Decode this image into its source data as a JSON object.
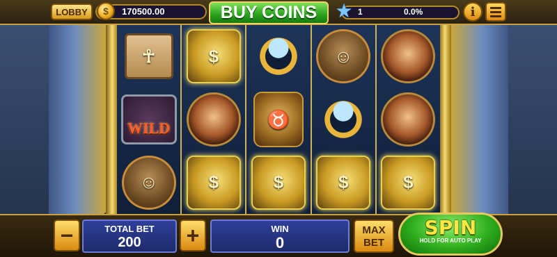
{
  "topbar": {
    "lobby_label": "LOBBY",
    "coin_balance": "170500.00",
    "buy_coins_label": "BUY COINS",
    "level": "1",
    "level_progress_pct": "0.0%",
    "level_progress": 0.0
  },
  "reels": [
    [
      "scarab",
      "wild",
      "mask"
    ],
    [
      "money-bag",
      "woman",
      "money-bag"
    ],
    [
      "ring",
      "beast",
      "money-bag"
    ],
    [
      "mask",
      "ring",
      "money-bag"
    ],
    [
      "man",
      "woman",
      "money-bag"
    ]
  ],
  "wild_text": "WILD",
  "controls": {
    "minus_label": "−",
    "plus_label": "+",
    "total_bet_label": "TOTAL BET",
    "total_bet_value": "200",
    "win_label": "WIN",
    "win_value": "0",
    "max_bet_line1": "MAX",
    "max_bet_line2": "BET",
    "spin_label": "SPIN",
    "spin_sub_label": "HOLD FOR AUTO PLAY"
  },
  "colors": {
    "gold": "#c9a23a",
    "buy_green": "#2aa11d",
    "bet_blue": "#2f3f9a",
    "spin_green": "#2fae1e"
  }
}
